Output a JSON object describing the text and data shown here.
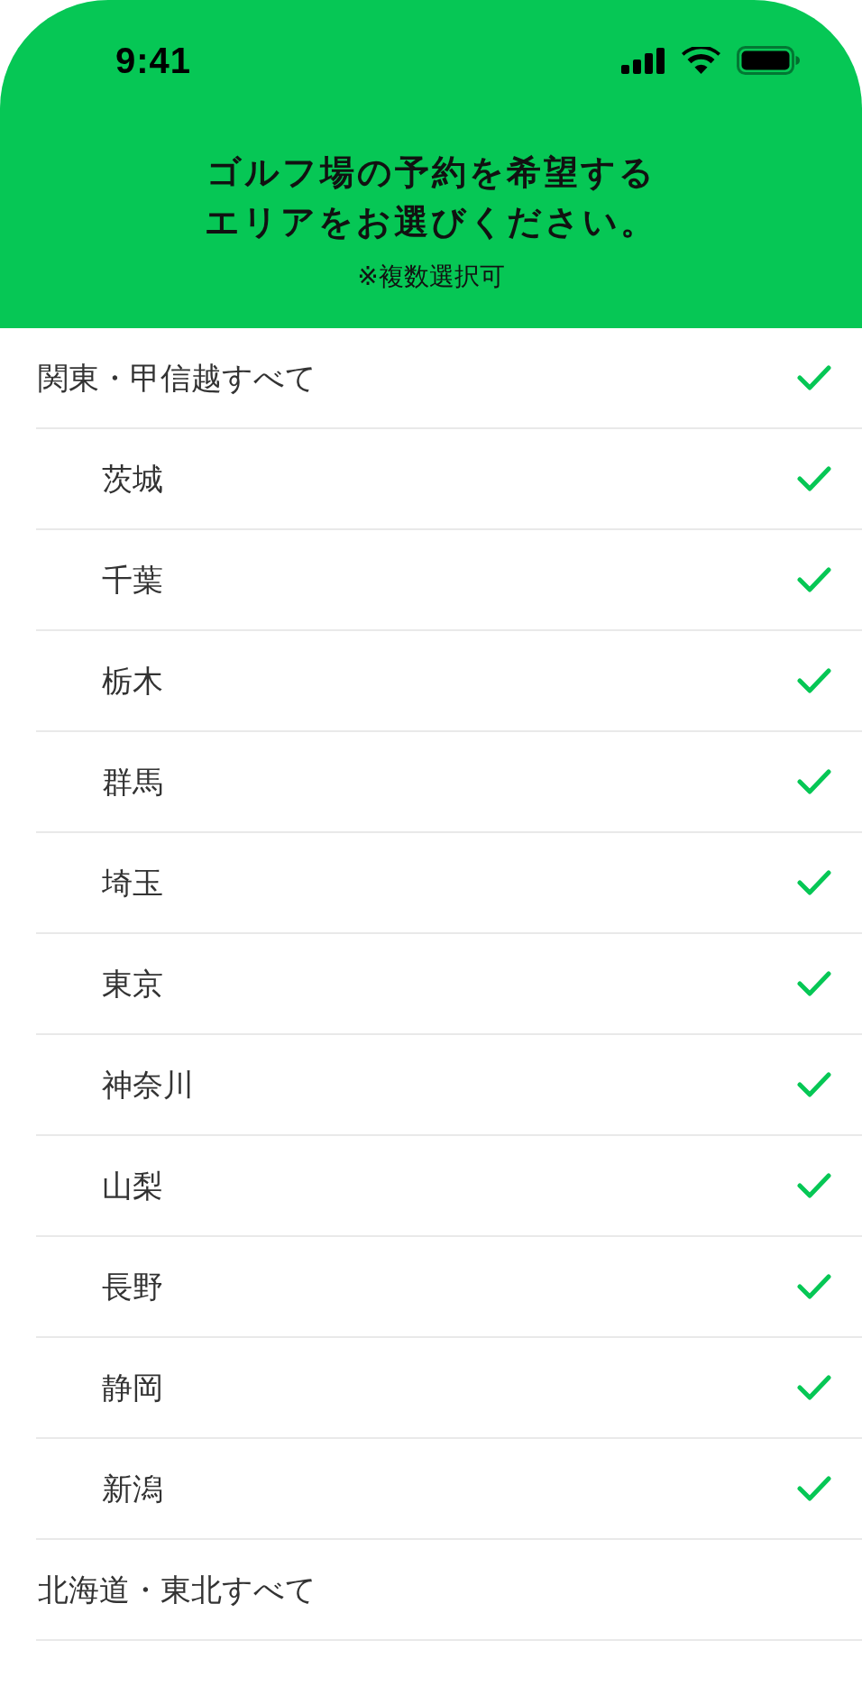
{
  "status_bar": {
    "time": "9:41"
  },
  "header": {
    "title": "ゴルフ場の予約を希望するエリアをお選びください。",
    "note": "※複数選択可"
  },
  "areas": [
    {
      "label": "関東・甲信越すべて",
      "checked": true,
      "children": [
        {
          "label": "茨城",
          "checked": true
        },
        {
          "label": "千葉",
          "checked": true
        },
        {
          "label": "栃木",
          "checked": true
        },
        {
          "label": "群馬",
          "checked": true
        },
        {
          "label": "埼玉",
          "checked": true
        },
        {
          "label": "東京",
          "checked": true
        },
        {
          "label": "神奈川",
          "checked": true
        },
        {
          "label": "山梨",
          "checked": true
        },
        {
          "label": "長野",
          "checked": true
        },
        {
          "label": "静岡",
          "checked": true
        },
        {
          "label": "新潟",
          "checked": true
        }
      ]
    },
    {
      "label": "北海道・東北すべて",
      "checked": false
    }
  ]
}
